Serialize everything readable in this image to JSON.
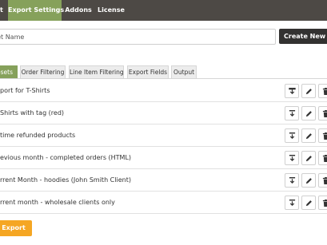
{
  "topnav": {
    "tabs": [
      {
        "label": "t"
      },
      {
        "label": "Export Settings"
      },
      {
        "label": "Addons"
      },
      {
        "label": "License"
      }
    ]
  },
  "preset_form": {
    "input_placeholder": "eset Name",
    "create_button": "Create New Pres"
  },
  "subtabs": [
    {
      "label": "esets"
    },
    {
      "label": "Order Filtering"
    },
    {
      "label": "Line Item Filtering"
    },
    {
      "label": "Export Fields"
    },
    {
      "label": "Output"
    }
  ],
  "presets": [
    {
      "name": "port for T-Shirts"
    },
    {
      "name": "Shirts with tag (red)"
    },
    {
      "name": "time refunded products"
    },
    {
      "name": "evious month - completed orders (HTML)"
    },
    {
      "name": "rrent Month - hoodies (John Smith Client)"
    },
    {
      "name": "rrent month - wholesale clients only"
    }
  ],
  "export_button": "Export",
  "colors": {
    "nav_bg": "#4d4945",
    "accent_green": "#86a15b",
    "dark_button": "#333231",
    "export_orange": "#f5a623"
  },
  "icons": {
    "row_actions": [
      "export-icon",
      "pencil-icon",
      "trash-icon"
    ]
  }
}
